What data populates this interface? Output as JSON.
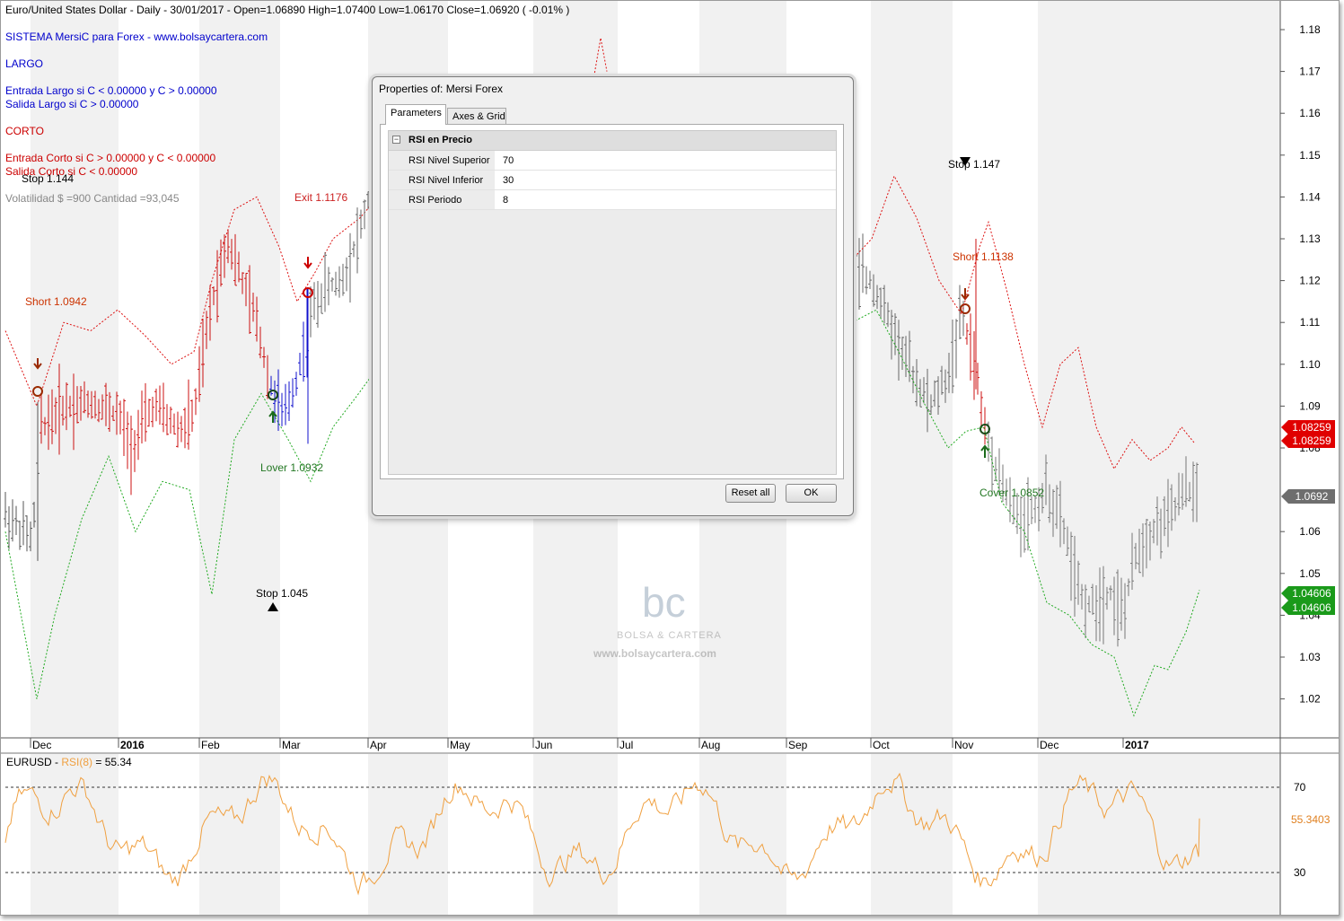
{
  "header": {
    "title_line": "Euro/United States Dollar - Daily - 30/01/2017 -   Open=1.06890   High=1.07400   Low=1.06170   Close=1.06920  ( -0.01% )",
    "system_name": "SISTEMA MersiC para Forex  -  www.bolsaycartera.com",
    "largo": "LARGO",
    "entrada_largo": "Entrada Largo si C < 0.00000  y  C > 0.00000",
    "salida_largo": "Salida Largo si    C > 0.00000",
    "corto": "CORTO",
    "entrada_corto": "Entrada Corto si  C > 0.00000  y  C < 0.00000",
    "salida_corto": "Salida Corto si    C < 0.00000",
    "volatilidad": "Volatilidad $ =900  Cantidad =93,045",
    "colors": {
      "blue": "#0000cc",
      "red": "#cc0000",
      "gray": "#888888"
    }
  },
  "price_axis": {
    "ticks": [
      "1.18",
      "1.17",
      "1.16",
      "1.15",
      "1.14",
      "1.13",
      "1.12",
      "1.11",
      "1.10",
      "1.09",
      "1.08",
      "1.06",
      "1.05",
      "1.04",
      "1.03",
      "1.02"
    ],
    "tick_values": [
      1.18,
      1.17,
      1.16,
      1.15,
      1.14,
      1.13,
      1.12,
      1.11,
      1.1,
      1.09,
      1.08,
      1.06,
      1.05,
      1.04,
      1.03,
      1.02
    ],
    "badges": [
      {
        "text": "1.08259",
        "value": 1.0826,
        "color": "#e00000"
      },
      {
        "text": "1.08259",
        "value": 1.0826,
        "color": "#e00000"
      },
      {
        "text": "1.0692",
        "value": 1.0692,
        "color": "#6e6e6e"
      },
      {
        "text": "1.04606",
        "value": 1.0461,
        "color": "#1a9a1a"
      },
      {
        "text": "1.04606",
        "value": 1.0461,
        "color": "#1a9a1a"
      }
    ]
  },
  "time_axis": {
    "months": [
      "Dec",
      "2016",
      "Feb",
      "Mar",
      "Apr",
      "May",
      "Jun",
      "Jul",
      "Aug",
      "Sep",
      "Oct",
      "Nov",
      "Dec",
      "2017"
    ]
  },
  "annotations": {
    "stop_1": "Stop   1.144",
    "exit_1": "Exit 1.1176",
    "short_1": "Short 1.0942",
    "long_cover_overlap": "Lover 1.0932",
    "stop_2": "Stop    1.045",
    "stop_3": "Stop    1.147",
    "short_2": "Short 1.1138",
    "cover_2": "Cover 1.0852"
  },
  "watermark": {
    "logo": "bc",
    "brand": "BOLSA & CARTERA",
    "url": "www.bolsaycartera.com"
  },
  "rsi_panel": {
    "label_prefix": "EURUSD - ",
    "label_indicator": "RSI(8)",
    "label_value": " = 55.34",
    "ticks": [
      "70",
      "30"
    ],
    "badge": "55.3403",
    "color": "#f0a040",
    "upper": 70,
    "lower": 30,
    "current": 55.34
  },
  "dialog": {
    "title": "Properties of: Mersi Forex",
    "tabs": [
      "Parameters",
      "Axes & Grid"
    ],
    "active_tab": "Parameters",
    "category": "RSI en Precio",
    "params": [
      {
        "name": "RSI Nivel Superior",
        "value": "70"
      },
      {
        "name": "RSI Nivel Inferior",
        "value": "30"
      },
      {
        "name": "RSI Periodo",
        "value": "8"
      }
    ],
    "reset_label": "Reset all",
    "ok_label": "OK"
  },
  "chart_data": {
    "type": "ohlc",
    "title": "Euro/United States Dollar - Daily - 30/01/2017",
    "ylim": [
      1.01,
      1.185
    ],
    "last": {
      "open": 1.0689,
      "high": 1.074,
      "low": 1.0617,
      "close": 1.0692
    },
    "trades": [
      {
        "type": "Short",
        "price": 1.0942,
        "exit": 1.1176
      },
      {
        "type": "Short",
        "price": 1.1138,
        "cover": 1.0852
      }
    ],
    "stops": [
      1.144,
      1.045,
      1.147
    ],
    "bands": {
      "upper_last": 1.0826,
      "lower_last": 1.0461
    }
  }
}
